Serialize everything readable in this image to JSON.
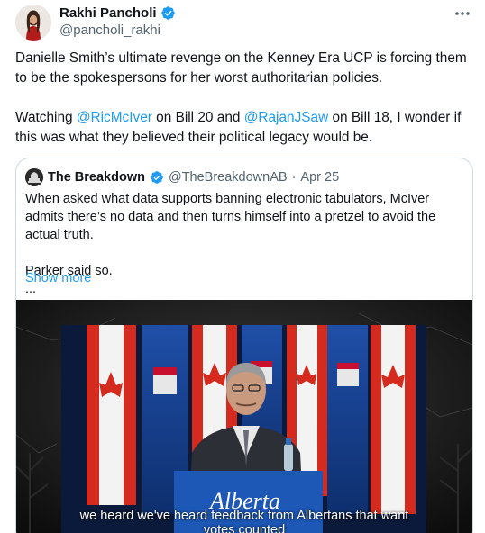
{
  "author": {
    "name": "Rakhi Pancholi",
    "handle": "@pancholi_rakhi",
    "verified_color": "#1d9bf0"
  },
  "tweet": {
    "para1": "Danielle Smith’s ultimate revenge on the Kenney Era UCP is forcing them to be the spokespersons for her worst authoritarian policies.",
    "para2": {
      "prefix": "Watching ",
      "mention1": "@RicMcIver",
      "middle1": " on Bill 20 and ",
      "mention2": "@RajanJSaw",
      "suffix": " on Bill 18, I wonder if this was what they believed their political legacy would be."
    }
  },
  "quote": {
    "name": "The Breakdown",
    "handle": "@TheBreakdownAB",
    "separator": "·",
    "date": "Apr 25",
    "text1": "When asked what data supports banning electronic tabulators, McIver admits there’s no data and then turns himself into a pretzel to avoid the actual truth.",
    "text2": "Parker said so.",
    "text3": "...",
    "show_more": "Show more"
  },
  "media": {
    "caption_line1": "we heard we've heard feedback from Albertans that want",
    "caption_line2": "votes counted",
    "podium_text": "Alberta"
  },
  "colors": {
    "accent": "#1d9bf0",
    "text": "#0f1419",
    "secondary": "#536471",
    "border": "#cfd9de"
  }
}
